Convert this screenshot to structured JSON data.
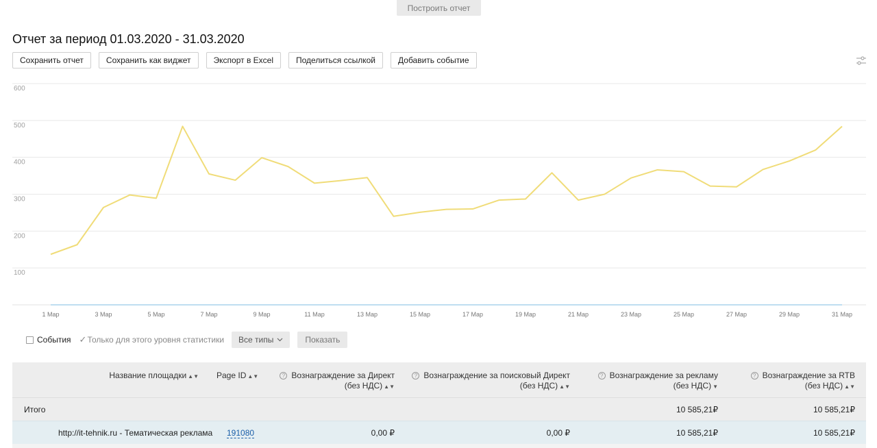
{
  "top_button": "Построить отчет",
  "title": "Отчет за период 01.03.2020 - 31.03.2020",
  "toolbar": {
    "save_report": "Сохранить отчет",
    "save_widget": "Сохранить как виджет",
    "export_excel": "Экспорт в Excel",
    "share_link": "Поделиться ссылкой",
    "add_event": "Добавить событие"
  },
  "chart_data": {
    "type": "line",
    "ylim": [
      0,
      600
    ],
    "y_ticks": [
      "600",
      "500",
      "400",
      "300",
      "200",
      "100"
    ],
    "x_tick_labels": [
      "1 Мар",
      "3 Мар",
      "5 Мар",
      "7 Мар",
      "9 Мар",
      "11 Мар",
      "13 Мар",
      "15 Мар",
      "17 Мар",
      "19 Мар",
      "21 Мар",
      "23 Мар",
      "25 Мар",
      "27 Мар",
      "29 Мар",
      "31 Мар"
    ],
    "x": [
      1,
      2,
      3,
      4,
      5,
      6,
      7,
      8,
      9,
      10,
      11,
      12,
      13,
      14,
      15,
      16,
      17,
      18,
      19,
      20,
      21,
      22,
      23,
      24,
      25,
      26,
      27,
      28,
      29,
      30,
      31
    ],
    "series": [
      {
        "color": "#f0dc78",
        "values": [
          137,
          163,
          264,
          298,
          289,
          484,
          355,
          338,
          399,
          375,
          330,
          337,
          345,
          240,
          251,
          259,
          260,
          284,
          287,
          358,
          284,
          300,
          344,
          366,
          361,
          322,
          320,
          367,
          390,
          420,
          484
        ]
      },
      {
        "color": "#a9d3ec",
        "values": [
          0,
          0,
          0,
          0,
          0,
          0,
          0,
          0,
          0,
          0,
          0,
          0,
          0,
          0,
          0,
          0,
          0,
          0,
          0,
          0,
          0,
          0,
          0,
          0,
          0,
          0,
          0,
          0,
          0,
          0,
          0
        ]
      }
    ],
    "grid": true
  },
  "filters": {
    "events_label": "События",
    "level_only_label": "Только для этого уровня статистики",
    "types_label": "Все типы",
    "show_label": "Показать"
  },
  "table": {
    "headers": {
      "site_name": "Название площадки",
      "page_id": "Page ID",
      "direct_line1": "Вознаграждение за Директ",
      "direct_line2": "(без НДС)",
      "search_direct_line1": "Вознаграждение за поисковый Директ",
      "search_direct_line2": "(без НДС)",
      "ads_line1": "Вознаграждение за рекламу",
      "ads_line2": "(без НДС)",
      "rtb_line1": "Вознаграждение за RTB",
      "rtb_line2": "(без НДС)"
    },
    "total": {
      "label": "Итого",
      "ads": "10 585,21₽",
      "rtb": "10 585,21₽"
    },
    "rows": [
      {
        "site": "http://it-tehnik.ru - Тематическая реклама",
        "page_id": "191080",
        "direct": "0,00 ₽",
        "search_direct": "0,00 ₽",
        "ads": "10 585,21₽",
        "rtb": "10 585,21₽"
      }
    ]
  }
}
